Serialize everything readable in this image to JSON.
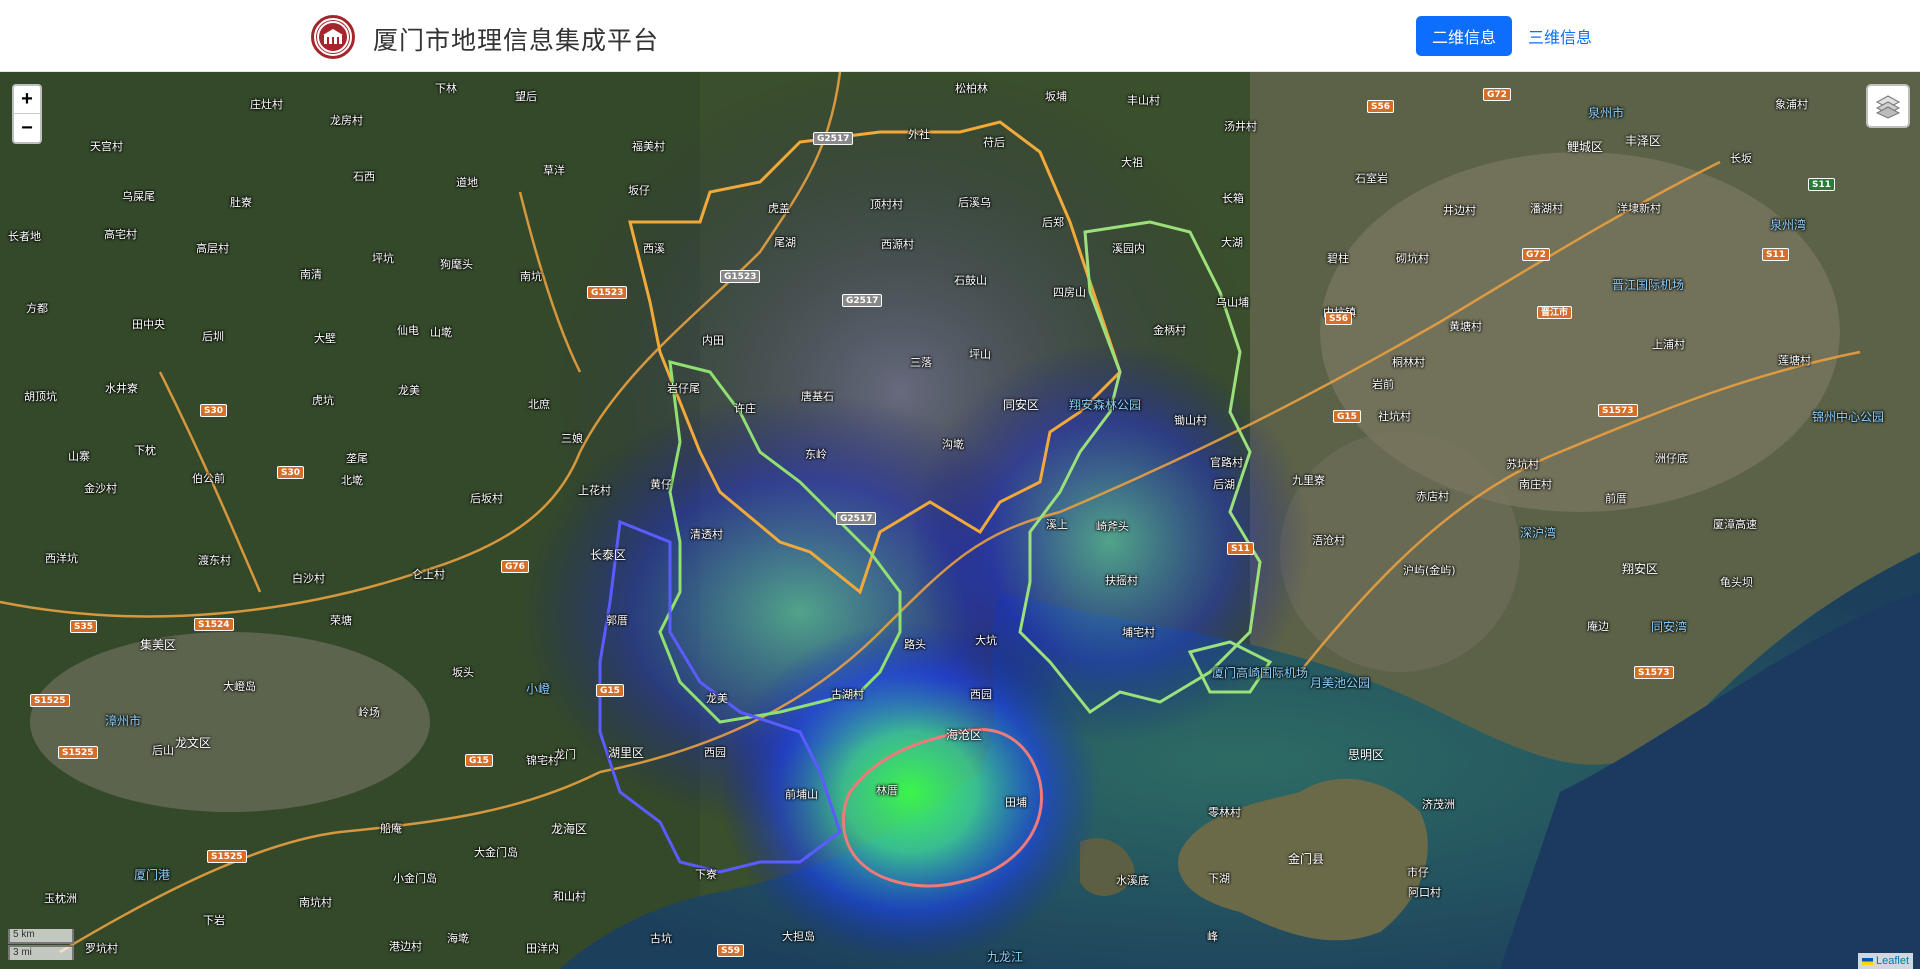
{
  "header": {
    "title": "厦门市地理信息集成平台",
    "nav": [
      {
        "label": "二维信息",
        "active": true
      },
      {
        "label": "三维信息",
        "active": false
      }
    ],
    "accent_color": "#0d6efd",
    "logo_color": "#a4262c"
  },
  "map": {
    "zoom_in": "+",
    "zoom_out": "−",
    "layers_icon": "layers-icon",
    "scale": {
      "metric": "5 km",
      "imperial": "3 mi"
    },
    "attribution": "Leaflet",
    "district_boundary_colors": {
      "翔安": "#7ed67a",
      "同安": "#f1a93a",
      "集美": "#8fe070",
      "海沧": "#4a4cff",
      "思明湖里": "#f07a7a"
    },
    "labels": [
      {
        "text": "庄灶村",
        "cls": ""
      },
      {
        "text": "龙房村",
        "cls": ""
      },
      {
        "text": "下林",
        "cls": ""
      },
      {
        "text": "望后",
        "cls": ""
      },
      {
        "text": "松柏林",
        "cls": ""
      },
      {
        "text": "坂埔",
        "cls": ""
      },
      {
        "text": "丰山村",
        "cls": ""
      },
      {
        "text": "汤井村",
        "cls": ""
      },
      {
        "text": "象浦村",
        "cls": ""
      },
      {
        "text": "天宫村",
        "cls": ""
      },
      {
        "text": "福美村",
        "cls": ""
      },
      {
        "text": "外社",
        "cls": ""
      },
      {
        "text": "苻后",
        "cls": ""
      },
      {
        "text": "大祖",
        "cls": ""
      },
      {
        "text": "泉州市",
        "cls": "water"
      },
      {
        "text": "鲤城区",
        "cls": "dist"
      },
      {
        "text": "丰泽区",
        "cls": "dist"
      },
      {
        "text": "长坂",
        "cls": ""
      },
      {
        "text": "乌屎尾",
        "cls": ""
      },
      {
        "text": "肚寮",
        "cls": ""
      },
      {
        "text": "石西",
        "cls": ""
      },
      {
        "text": "道地",
        "cls": ""
      },
      {
        "text": "草洋",
        "cls": ""
      },
      {
        "text": "坂仔",
        "cls": ""
      },
      {
        "text": "虎盖",
        "cls": ""
      },
      {
        "text": "顶村村",
        "cls": ""
      },
      {
        "text": "后溪乌",
        "cls": ""
      },
      {
        "text": "后郑",
        "cls": ""
      },
      {
        "text": "长箱",
        "cls": ""
      },
      {
        "text": "石室岩",
        "cls": ""
      },
      {
        "text": "井边村",
        "cls": ""
      },
      {
        "text": "潘湖村",
        "cls": ""
      },
      {
        "text": "洋埭新村",
        "cls": ""
      },
      {
        "text": "泉州湾",
        "cls": "water"
      },
      {
        "text": "长者地",
        "cls": ""
      },
      {
        "text": "高宅村",
        "cls": ""
      },
      {
        "text": "高层村",
        "cls": ""
      },
      {
        "text": "坪坑",
        "cls": ""
      },
      {
        "text": "狗麾头",
        "cls": ""
      },
      {
        "text": "南坑",
        "cls": ""
      },
      {
        "text": "西溪",
        "cls": ""
      },
      {
        "text": "尾湖",
        "cls": ""
      },
      {
        "text": "西源村",
        "cls": ""
      },
      {
        "text": "溪园内",
        "cls": ""
      },
      {
        "text": "大湖",
        "cls": ""
      },
      {
        "text": "碧柱",
        "cls": ""
      },
      {
        "text": "砌坑村",
        "cls": ""
      },
      {
        "text": "南清",
        "cls": ""
      },
      {
        "text": "石鼓山",
        "cls": ""
      },
      {
        "text": "四房山",
        "cls": ""
      },
      {
        "text": "乌山埔",
        "cls": ""
      },
      {
        "text": "晋江国际机场",
        "cls": "water"
      },
      {
        "text": "方都",
        "cls": ""
      },
      {
        "text": "田中央",
        "cls": ""
      },
      {
        "text": "后圳",
        "cls": ""
      },
      {
        "text": "大壁",
        "cls": ""
      },
      {
        "text": "仙电",
        "cls": ""
      },
      {
        "text": "山墘",
        "cls": ""
      },
      {
        "text": "内田",
        "cls": ""
      },
      {
        "text": "金柄村",
        "cls": ""
      },
      {
        "text": "内坑镇",
        "cls": ""
      },
      {
        "text": "黄塘村",
        "cls": ""
      },
      {
        "text": "上浦村",
        "cls": ""
      },
      {
        "text": "胡顶坑",
        "cls": ""
      },
      {
        "text": "水井寮",
        "cls": ""
      },
      {
        "text": "虎坑",
        "cls": ""
      },
      {
        "text": "龙美",
        "cls": ""
      },
      {
        "text": "北庶",
        "cls": ""
      },
      {
        "text": "三落",
        "cls": ""
      },
      {
        "text": "坪山",
        "cls": ""
      },
      {
        "text": "桐林村",
        "cls": ""
      },
      {
        "text": "莲塘村",
        "cls": ""
      },
      {
        "text": "岩前",
        "cls": ""
      },
      {
        "text": "岩仔尾",
        "cls": ""
      },
      {
        "text": "许庄",
        "cls": ""
      },
      {
        "text": "唐基石",
        "cls": ""
      },
      {
        "text": "同安区",
        "cls": "dist"
      },
      {
        "text": "翔安森林公园",
        "cls": "water"
      },
      {
        "text": "锄山村",
        "cls": ""
      },
      {
        "text": "社坑村",
        "cls": ""
      },
      {
        "text": "锦州中心公园",
        "cls": "water"
      },
      {
        "text": "山寨",
        "cls": ""
      },
      {
        "text": "下枕",
        "cls": ""
      },
      {
        "text": "垄尾",
        "cls": ""
      },
      {
        "text": "三娘",
        "cls": ""
      },
      {
        "text": "东岭",
        "cls": ""
      },
      {
        "text": "沟墘",
        "cls": ""
      },
      {
        "text": "官路村",
        "cls": ""
      },
      {
        "text": "九里寮",
        "cls": ""
      },
      {
        "text": "苏坑村",
        "cls": ""
      },
      {
        "text": "洲仔底",
        "cls": ""
      },
      {
        "text": "金沙村",
        "cls": ""
      },
      {
        "text": "伯公前",
        "cls": ""
      },
      {
        "text": "北墘",
        "cls": ""
      },
      {
        "text": "黄仔",
        "cls": ""
      },
      {
        "text": "上花村",
        "cls": ""
      },
      {
        "text": "后坂村",
        "cls": ""
      },
      {
        "text": "后湖",
        "cls": ""
      },
      {
        "text": "赤店村",
        "cls": ""
      },
      {
        "text": "南庄村",
        "cls": ""
      },
      {
        "text": "前厝",
        "cls": ""
      },
      {
        "text": "溪上",
        "cls": ""
      },
      {
        "text": "崎斧头",
        "cls": ""
      },
      {
        "text": "清透村",
        "cls": ""
      },
      {
        "text": "深沪湾",
        "cls": "water"
      },
      {
        "text": "厦漳高速",
        "cls": ""
      },
      {
        "text": "浯沧村",
        "cls": ""
      },
      {
        "text": "西洋坑",
        "cls": ""
      },
      {
        "text": "渡东村",
        "cls": ""
      },
      {
        "text": "长泰区",
        "cls": "dist"
      },
      {
        "text": "白沙村",
        "cls": ""
      },
      {
        "text": "仑上村",
        "cls": ""
      },
      {
        "text": "沪屿(金屿)",
        "cls": ""
      },
      {
        "text": "翔安区",
        "cls": "dist"
      },
      {
        "text": "龟头坝",
        "cls": ""
      },
      {
        "text": "扶摇村",
        "cls": ""
      },
      {
        "text": "郭厝",
        "cls": ""
      },
      {
        "text": "荣塘",
        "cls": ""
      },
      {
        "text": "埔宅村",
        "cls": ""
      },
      {
        "text": "庵边",
        "cls": ""
      },
      {
        "text": "同安湾",
        "cls": "water"
      },
      {
        "text": "集美区",
        "cls": "dist"
      },
      {
        "text": "大坑",
        "cls": ""
      },
      {
        "text": "路头",
        "cls": ""
      },
      {
        "text": "坂头",
        "cls": ""
      },
      {
        "text": "大嶝岛",
        "cls": ""
      },
      {
        "text": "小嶝",
        "cls": "water"
      },
      {
        "text": "厦门高崎国际机场",
        "cls": "water"
      },
      {
        "text": "月美池公园",
        "cls": "water"
      },
      {
        "text": "西园",
        "cls": ""
      },
      {
        "text": "古湖村",
        "cls": ""
      },
      {
        "text": "龙美",
        "cls": ""
      },
      {
        "text": "漳州市",
        "cls": "water"
      },
      {
        "text": "岭场",
        "cls": ""
      },
      {
        "text": "龙文区",
        "cls": "dist"
      },
      {
        "text": "后山",
        "cls": ""
      },
      {
        "text": "锦宅村",
        "cls": ""
      },
      {
        "text": "龙门",
        "cls": ""
      },
      {
        "text": "湖里区",
        "cls": "dist"
      },
      {
        "text": "西园",
        "cls": ""
      },
      {
        "text": "海沧区",
        "cls": "dist"
      },
      {
        "text": "思明区",
        "cls": "dist"
      },
      {
        "text": "前埔山",
        "cls": ""
      },
      {
        "text": "林厝",
        "cls": ""
      },
      {
        "text": "田埔",
        "cls": ""
      },
      {
        "text": "零林村",
        "cls": ""
      },
      {
        "text": "济茂洲",
        "cls": ""
      },
      {
        "text": "船庵",
        "cls": ""
      },
      {
        "text": "龙海区",
        "cls": "dist"
      },
      {
        "text": "大金门岛",
        "cls": ""
      },
      {
        "text": "金门县",
        "cls": "dist"
      },
      {
        "text": "下湖",
        "cls": ""
      },
      {
        "text": "市仔",
        "cls": ""
      },
      {
        "text": "阿口村",
        "cls": ""
      },
      {
        "text": "厦门港",
        "cls": "water"
      },
      {
        "text": "小金门岛",
        "cls": ""
      },
      {
        "text": "下寮",
        "cls": ""
      },
      {
        "text": "水溪底",
        "cls": ""
      },
      {
        "text": "玉枕洲",
        "cls": ""
      },
      {
        "text": "南坑村",
        "cls": ""
      },
      {
        "text": "和山村",
        "cls": ""
      },
      {
        "text": "下岩",
        "cls": ""
      },
      {
        "text": "罗坑村",
        "cls": ""
      },
      {
        "text": "港边村",
        "cls": ""
      },
      {
        "text": "海墘",
        "cls": ""
      },
      {
        "text": "田洋内",
        "cls": ""
      },
      {
        "text": "古坑",
        "cls": ""
      },
      {
        "text": "大担岛",
        "cls": ""
      },
      {
        "text": "峰",
        "cls": ""
      },
      {
        "text": "九龙江",
        "cls": "water"
      }
    ],
    "shields": [
      {
        "text": "G2517",
        "cls": "grey"
      },
      {
        "text": "G72",
        "cls": "orange"
      },
      {
        "text": "S56",
        "cls": "orange"
      },
      {
        "text": "S11",
        "cls": "green"
      },
      {
        "text": "G1523",
        "cls": "grey"
      },
      {
        "text": "G2517",
        "cls": "grey"
      },
      {
        "text": "G1523",
        "cls": "orange"
      },
      {
        "text": "G72",
        "cls": "orange"
      },
      {
        "text": "S11",
        "cls": "orange"
      },
      {
        "text": "S56",
        "cls": "orange"
      },
      {
        "text": "晋江市",
        "cls": "orange"
      },
      {
        "text": "S30",
        "cls": "orange"
      },
      {
        "text": "S1573",
        "cls": "orange"
      },
      {
        "text": "G15",
        "cls": "orange"
      },
      {
        "text": "S30",
        "cls": "orange"
      },
      {
        "text": "G2517",
        "cls": "grey"
      },
      {
        "text": "S11",
        "cls": "orange"
      },
      {
        "text": "G76",
        "cls": "orange"
      },
      {
        "text": "S35",
        "cls": "orange"
      },
      {
        "text": "S1524",
        "cls": "orange"
      },
      {
        "text": "G15",
        "cls": "orange"
      },
      {
        "text": "S1525",
        "cls": "orange"
      },
      {
        "text": "S1525",
        "cls": "orange"
      },
      {
        "text": "G15",
        "cls": "orange"
      },
      {
        "text": "S1573",
        "cls": "orange"
      },
      {
        "text": "S1525",
        "cls": "orange"
      },
      {
        "text": "S59",
        "cls": "orange"
      }
    ]
  }
}
